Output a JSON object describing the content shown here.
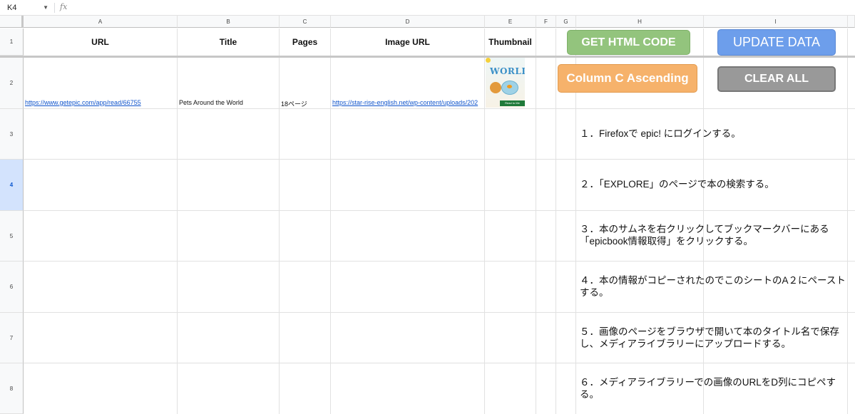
{
  "formula_bar": {
    "cell_ref": "K4",
    "fx_label": "fx"
  },
  "columns": [
    "A",
    "B",
    "C",
    "D",
    "E",
    "F",
    "G",
    "H",
    "I"
  ],
  "rows": [
    "1",
    "2",
    "3",
    "4",
    "5",
    "6",
    "7",
    "8"
  ],
  "selected_row": "4",
  "headers": {
    "url": "URL",
    "title": "Title",
    "pages": "Pages",
    "image_url": "Image URL",
    "thumbnail": "Thumbnail"
  },
  "row2": {
    "url": "https://www.getepic.com/app/read/66755",
    "title": "Pets Around the World",
    "pages": "18ページ",
    "image_url": "https://star-rise-english.net/wp-content/uploads/202",
    "thumbnail_icon": "book-cover-thumbnail",
    "thumbnail_title": "WORLD",
    "thumbnail_read": "Read to Me"
  },
  "buttons": {
    "get_html": "GET HTML CODE",
    "update_data": "UPDATE DATA",
    "sort_c": "Column C Ascending",
    "clear_all": "CLEAR ALL"
  },
  "steps": [
    "１．Firefoxで epic! にログインする。",
    "２．「EXPLORE」のページで本の検索する。",
    "３．本のサムネを右クリックしてブックマークバーにある「epicbook情報取得」をクリックする。",
    "４．本の情報がコピーされたのでこのシートのA２にペーストする。",
    "５．画像のページをブラウザで開いて本のタイトル名で保存し、メディアライブラリーにアップロードする。",
    "６．メディアライブラリーでの画像のURLをD列にコピペする。"
  ],
  "colors": {
    "green": "#93c47d",
    "blue": "#6d9eeb",
    "orange": "#f6b26b",
    "gray": "#999999",
    "link": "#1155cc",
    "selected_header": "#d3e3fd"
  }
}
